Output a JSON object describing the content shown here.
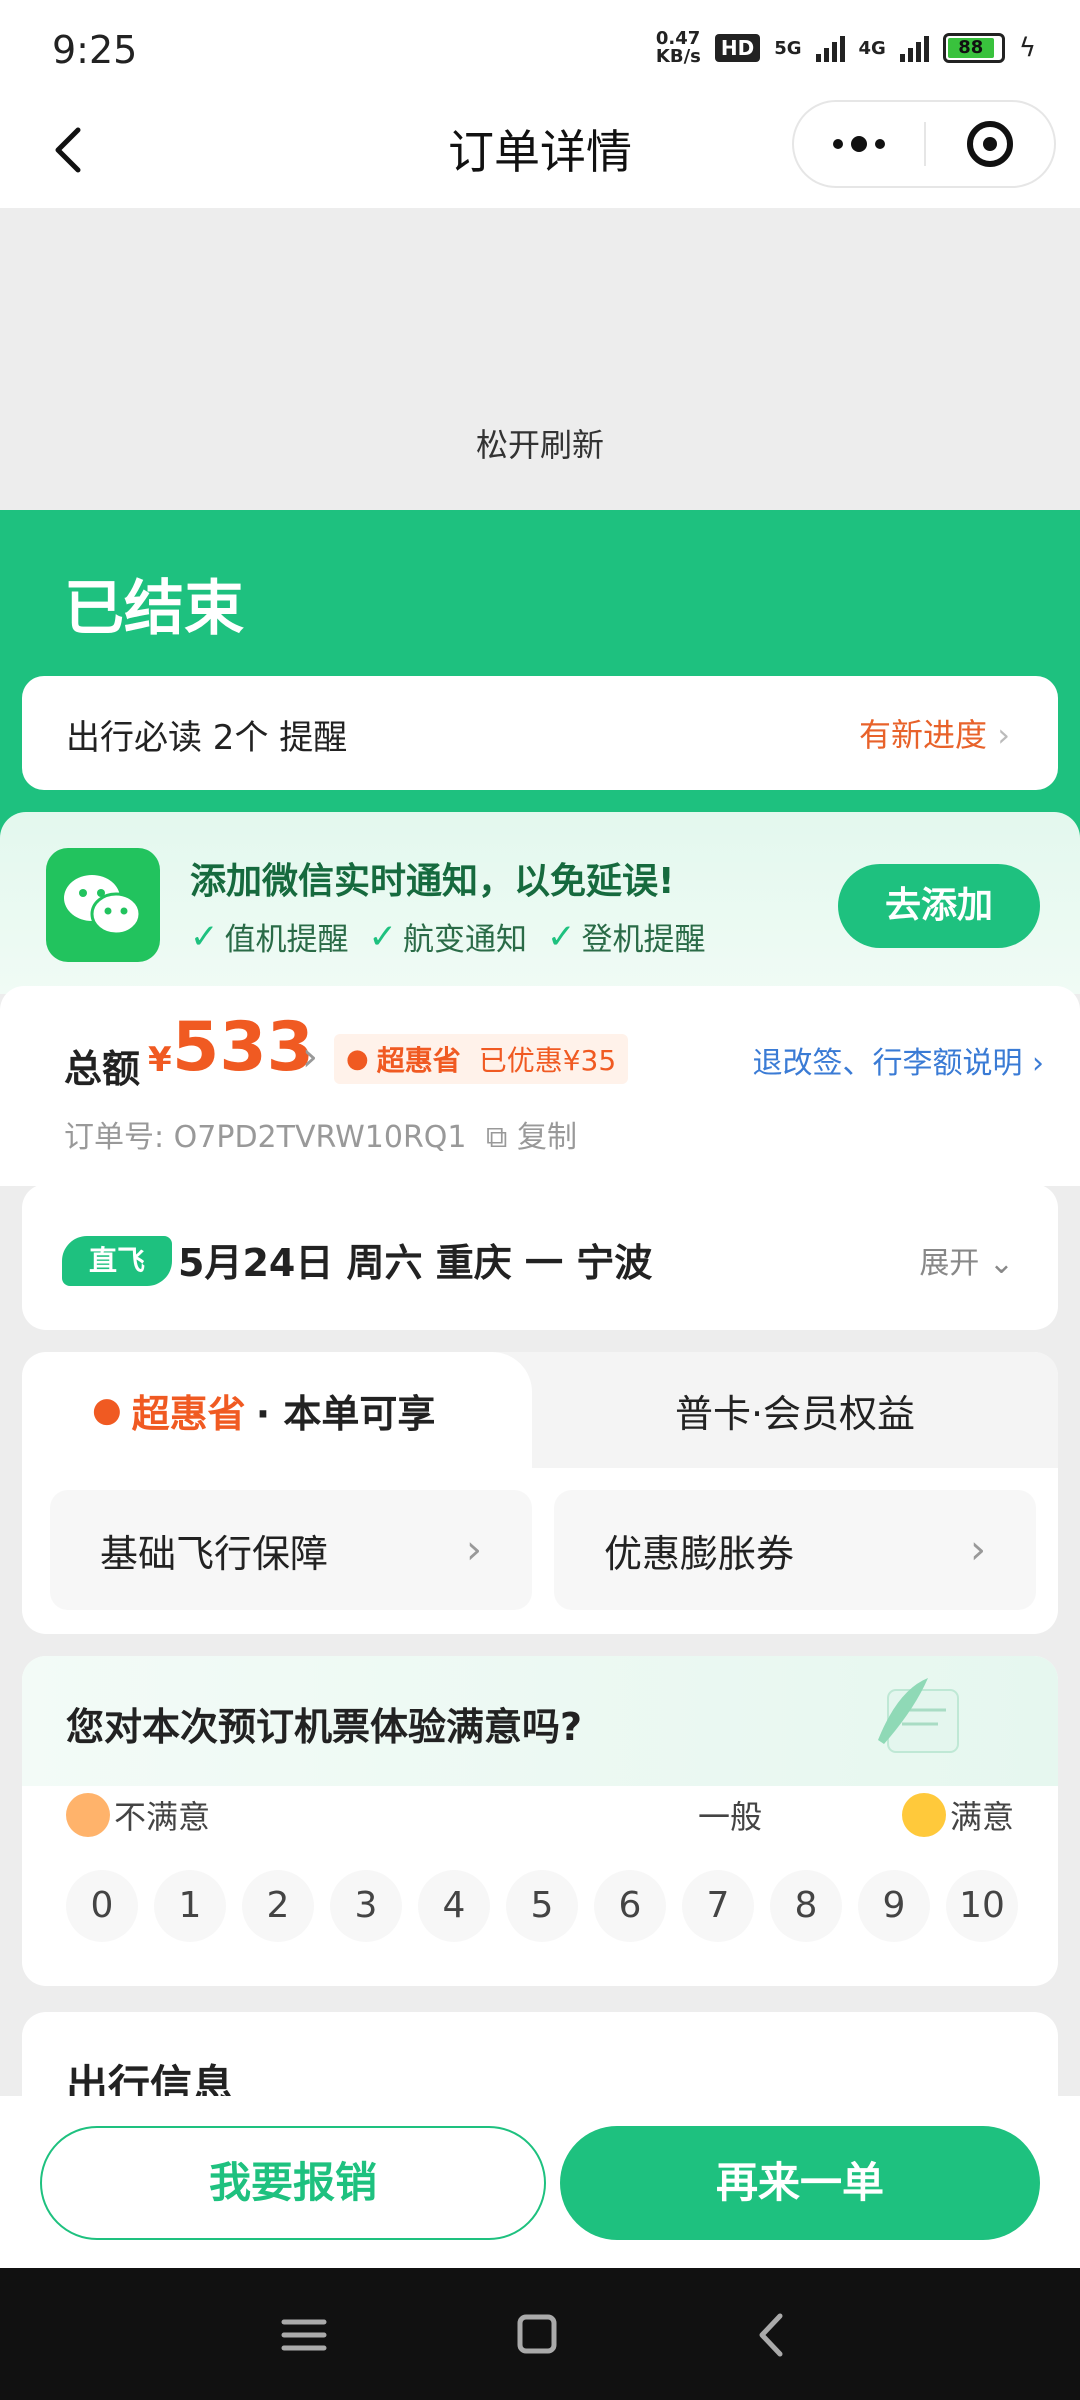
{
  "status_bar": {
    "time": "9:25",
    "net_speed": "0.47",
    "net_unit": "KB/s",
    "hd": "HD",
    "sim1": "5G",
    "sim2": "4G",
    "battery": "88"
  },
  "nav": {
    "title": "订单详情",
    "icons": [
      "back-icon",
      "more-icon",
      "close-target-icon"
    ]
  },
  "refresh": {
    "text": "松开刷新"
  },
  "order": {
    "status": "已结束",
    "notice_left": "出行必读 2个 提醒",
    "notice_right": "有新进度",
    "wechat": {
      "title": "添加微信实时通知，以免延误!",
      "checks": [
        "值机提醒",
        "航变通知",
        "登机提醒"
      ],
      "button": "去添加"
    },
    "total_label": "总额",
    "currency": "¥",
    "total_amount": "533",
    "discount_brand": "超惠省",
    "discount_text": "已优惠¥35",
    "rules_link": "退改签、行李额说明",
    "order_no_label": "订单号:",
    "order_no": "O7PD2TVRW10RQ1",
    "copy_label": "复制"
  },
  "flight": {
    "tag": "直飞",
    "info": "5月24日 周六 重庆 一 宁波",
    "expand": "展开"
  },
  "benefits": {
    "tab1_brand": "超惠省",
    "tab1_suffix": "· 本单可享",
    "tab2": "普卡·会员权益",
    "items": [
      "基础飞行保障",
      "优惠膨胀券"
    ]
  },
  "survey": {
    "question": "您对本次预订机票体验满意吗?",
    "low": "不满意",
    "mid": "一般",
    "high": "满意",
    "scores": [
      "0",
      "1",
      "2",
      "3",
      "4",
      "5",
      "6",
      "7",
      "8",
      "9",
      "10"
    ]
  },
  "travel": {
    "heading": "出行信息"
  },
  "actions": {
    "reimburse": "我要报销",
    "reorder": "再来一单"
  },
  "colors": {
    "brand_green": "#1ec17f",
    "accent_orange": "#f05a22",
    "link_blue": "#3a7bd5"
  }
}
